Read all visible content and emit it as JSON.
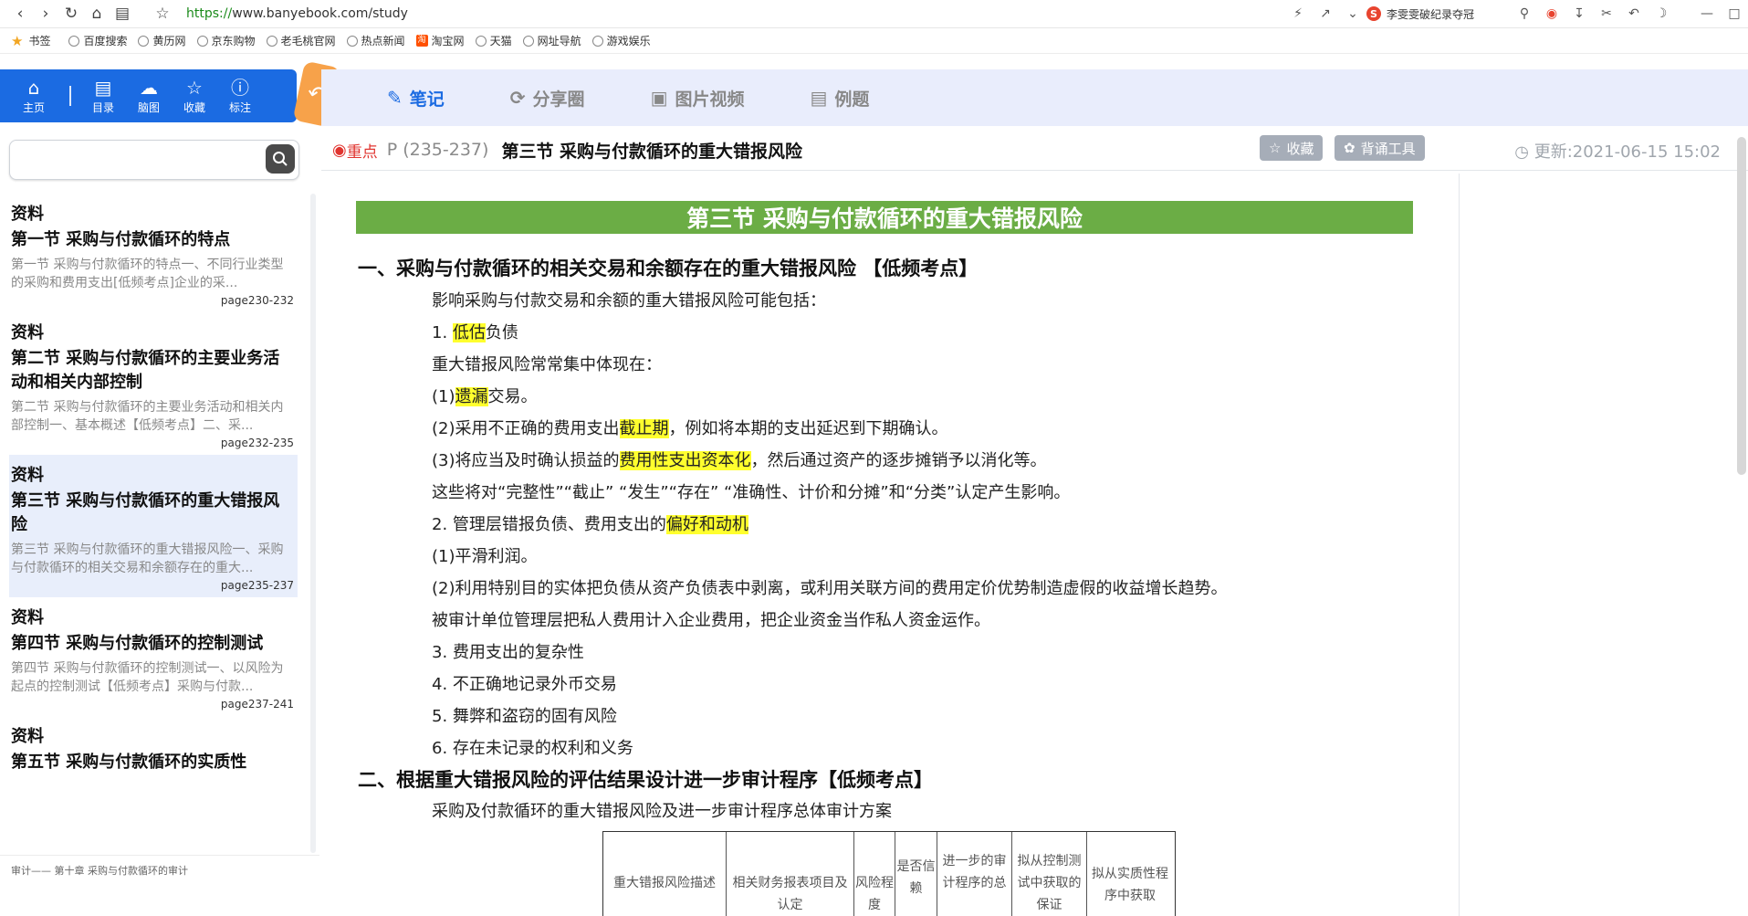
{
  "browser": {
    "url_scheme": "https://",
    "url_rest": "www.banyebook.com/study",
    "game_text": "李雯雯破纪录夺冠",
    "bookmarks": [
      "书签",
      "百度搜索",
      "黄历网",
      "京东购物",
      "老毛桃官网",
      "热点新闻",
      "淘宝网",
      "天猫",
      "网址导航",
      "游戏娱乐"
    ]
  },
  "toolbar": {
    "items": [
      {
        "label": "主页",
        "icon": "home-icon"
      },
      {
        "label": "目录",
        "icon": "catalog-icon"
      },
      {
        "label": "脑图",
        "icon": "mindmap-icon"
      },
      {
        "label": "收藏",
        "icon": "star-icon"
      },
      {
        "label": "标注",
        "icon": "help-icon"
      }
    ]
  },
  "search": {
    "placeholder": ""
  },
  "list": [
    {
      "kind": "资料",
      "title": "第一节 采购与付款循环的特点",
      "desc": "第一节 采购与付款循环的特点一、不同行业类型的采购和费用支出[低频考点]企业的采...",
      "page": "page230-232"
    },
    {
      "kind": "资料",
      "title": "第二节 采购与付款循环的主要业务活动和相关内部控制",
      "desc": "第二节 采购与付款循环的主要业务活动和相关内部控制一、基本概述【低频考点】二、采...",
      "page": "page232-235"
    },
    {
      "kind": "资料",
      "title": "第三节 采购与付款循环的重大错报风险",
      "desc": "第三节 采购与付款循环的重大错报风险一、采购与付款循环的相关交易和余额存在的重大...",
      "page": "page235-237",
      "active": true
    },
    {
      "kind": "资料",
      "title": "第四节 采购与付款循环的控制测试",
      "desc": "第四节 采购与付款循环的控制测试一、以风险为起点的控制测试【低频考点】采购与付款...",
      "page": "page237-241"
    },
    {
      "kind": "资料",
      "title": "第五节 采购与付款循环的实质性",
      "desc": "",
      "page": ""
    }
  ],
  "footer": "审计—— 第十章 采购与付款循环的审计",
  "tabs": [
    {
      "label": "笔记",
      "icon": "edit-icon",
      "active": true
    },
    {
      "label": "分享圈",
      "icon": "share-icon"
    },
    {
      "label": "图片视频",
      "icon": "media-icon"
    },
    {
      "label": "例题",
      "icon": "doc-icon"
    }
  ],
  "header": {
    "key": "重点",
    "pages": "P (235-237)",
    "title": "第三节 采购与付款循环的重大错报风险",
    "fav": "收藏",
    "tool": "背诵工具",
    "updated": "更新:2021-06-15 15:02"
  },
  "doc": {
    "banner": "第三节 采购与付款循环的重大错报风险",
    "h1": "一、采购与付款循环的相关交易和余额存在的重大错报风险 【低频考点】",
    "p1": "影响采购与付款交易和余额的重大错报风险可能包括：",
    "p2a": "1. ",
    "p2h": "低估",
    "p2b": "负债",
    "p3": "重大错报风险常常集中体现在：",
    "p4a": "(1)",
    "p4h": "遗漏",
    "p4b": "交易。",
    "p5a": "(2)采用不正确的费用支出",
    "p5h": "截止期",
    "p5b": "，例如将本期的支出延迟到下期确认。",
    "p6a": "(3)将应当及时确认损益的",
    "p6h": "费用性支出资本化",
    "p6b": "，然后通过资产的逐步摊销予以消化等。",
    "p7": "这些将对“完整性”“截止”  “发生”“存在”  “准确性、计价和分摊”和“分类”认定产生影响。",
    "p8a": "2. 管理层错报负债、费用支出的",
    "p8h": "偏好和动机",
    "p9": "(1)平滑利润。",
    "p10": "(2)利用特别目的实体把负债从资产负债表中剥离，或利用关联方间的费用定价优势制造虚假的收益增长趋势。",
    "p11": "被审计单位管理层把私人费用计入企业费用，把企业资金当作私人资金运作。",
    "p12": "3. 费用支出的复杂性",
    "p13": "4. 不正确地记录外币交易",
    "p14": "5. 舞弊和盗窃的固有风险",
    "p15": "6. 存在未记录的权利和义务",
    "h2": "二、根据重大错报风险的评估结果设计进一步审计程序【低频考点】",
    "p16": "采购及付款循环的重大错报风险及进一步审计程序总体审计方案",
    "table": [
      "重大错报风险描述",
      "相关财务报表项目及认定",
      "风险程度",
      "是否信赖",
      "进一步的审计程序的总",
      "拟从控制测试中获取的保证",
      "拟从实质性程序中获取"
    ]
  }
}
